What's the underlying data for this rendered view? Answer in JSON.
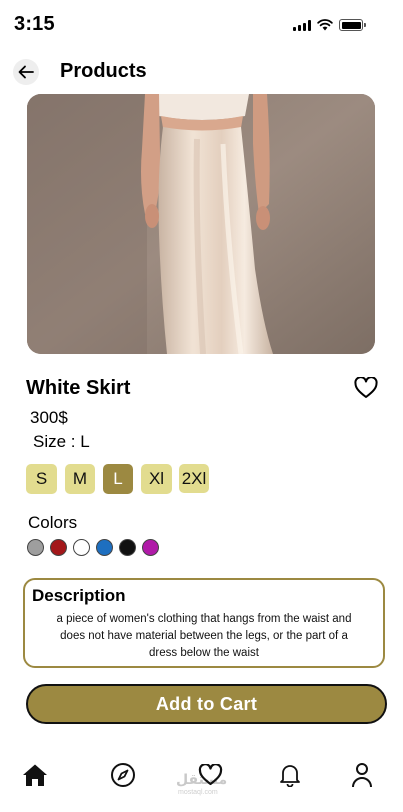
{
  "status_bar": {
    "time": "3:15",
    "icons": [
      "signal-icon",
      "wifi-icon",
      "battery-icon"
    ]
  },
  "header": {
    "title": "Products",
    "back_icon": "arrow-left-icon"
  },
  "product": {
    "name": "White Skirt",
    "price": "300$",
    "size_line": "Size : L",
    "favorite_icon": "heart-outline-icon",
    "image_description_icon": "product-photo"
  },
  "sizes": [
    {
      "label": "S",
      "selected": false
    },
    {
      "label": "M",
      "selected": false
    },
    {
      "label": "L",
      "selected": true
    },
    {
      "label": "Xl",
      "selected": false
    },
    {
      "label": "2Xl",
      "selected": false
    }
  ],
  "colors": {
    "label": "Colors",
    "swatches": [
      "#9e9e9e",
      "#a3171a",
      "#ffffff",
      "#1e6fc0",
      "#111111",
      "#b01aa8"
    ]
  },
  "description": {
    "title": "Description",
    "text": "a piece of women's clothing that hangs from the waist and does not have material between the legs, or the part of a dress below the waist"
  },
  "cart": {
    "label": "Add to Cart"
  },
  "tabbar": {
    "items": [
      "home-icon",
      "compass-icon",
      "heart-icon",
      "bell-icon",
      "profile-icon"
    ]
  },
  "watermark": {
    "text": "مستقل",
    "sub": "mostaql.com"
  },
  "theme": {
    "accent": "#9c8941",
    "chip": "#e2dc8f"
  }
}
